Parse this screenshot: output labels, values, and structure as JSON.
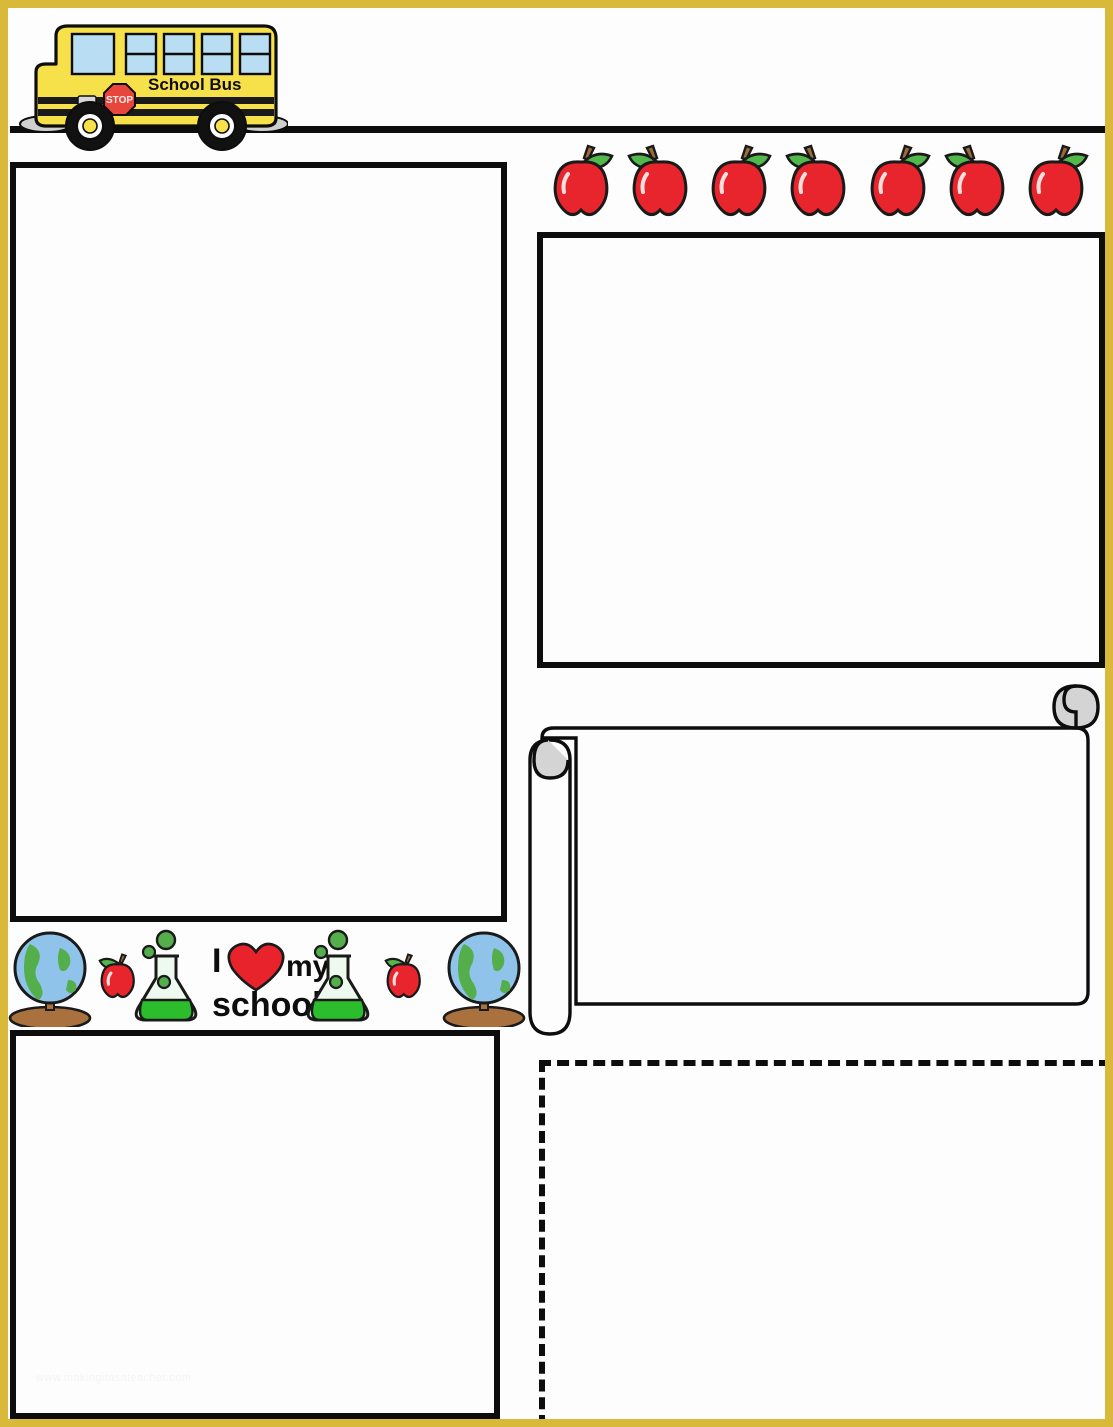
{
  "document": {
    "type": "Editable school newsletter template",
    "title_placeholder": "",
    "watermark": "www.makingitasateacher.com"
  },
  "theme": {
    "frame_color": "#d9b93a",
    "outline_color": "#0d0d0d",
    "page_background": "#ffffff",
    "apple_red": "#e8252c",
    "apple_leaf_green": "#53b84b",
    "apple_stem_brown": "#9c6b3a",
    "bus_yellow": "#f7e14a",
    "bus_window_blue": "#b9ddf2",
    "stop_sign_red": "#e8453c",
    "globe_ocean_blue": "#8fc3ea",
    "globe_land_green": "#54ae4b",
    "globe_base_brown": "#a9713d",
    "flask_liquid_green": "#2bbd2b",
    "heart_red": "#e8232b",
    "scroll_roll_gray": "#d4d4d4"
  },
  "header": {
    "name": "masthead",
    "title": "",
    "bus_clipart": {
      "label": "School Bus",
      "stop_sign_text": "STOP",
      "window_count": 5,
      "wheel_count": 2
    }
  },
  "decorations": {
    "apple_strip": {
      "name": "apple-border-strip",
      "count": 7,
      "leaf_sides": [
        "right",
        "left",
        "right",
        "left",
        "right",
        "left",
        "right"
      ]
    },
    "school_banner": {
      "name": "i-love-my-school-banner",
      "line_1": "I",
      "heart": "♥",
      "line_1_after": "my",
      "line_2": "school!",
      "items": [
        "globe",
        "apple",
        "flask",
        "text",
        "flask",
        "apple",
        "globe"
      ]
    }
  },
  "content_areas": [
    {
      "id": "left-main-box",
      "name": "main-article-box",
      "border_style": "solid",
      "text": ""
    },
    {
      "id": "right-top-box",
      "name": "announcements-box",
      "border_style": "solid",
      "text": ""
    },
    {
      "id": "scroll-box",
      "name": "scroll-note-box",
      "border_style": "scroll",
      "text": ""
    },
    {
      "id": "left-bottom-box",
      "name": "secondary-article-box",
      "border_style": "solid",
      "text": ""
    },
    {
      "id": "dashdot-box",
      "name": "reminders-box",
      "border_style": "dash-dot",
      "text": ""
    }
  ]
}
